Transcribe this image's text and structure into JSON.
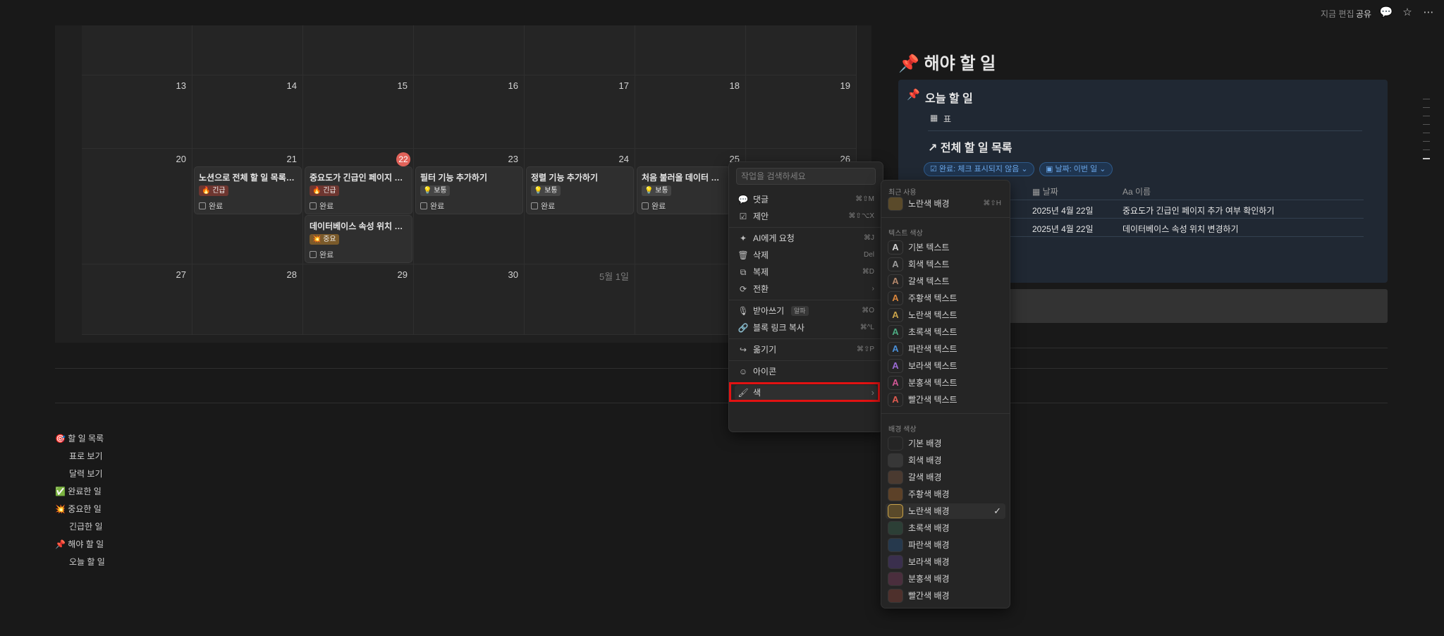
{
  "topbar": {
    "edit_status": "지금 편집",
    "share": "공유",
    "comment_icon": "comment-icon",
    "star_icon": "star-icon",
    "more_icon": "more-icon"
  },
  "calendar": {
    "row1": [
      "13",
      "14",
      "15",
      "16",
      "17",
      "18",
      "19"
    ],
    "row2": [
      "20",
      "21",
      "22",
      "23",
      "24",
      "25",
      "26"
    ],
    "row3": [
      "27",
      "28",
      "29",
      "30",
      "5월 1일"
    ],
    "today": "22",
    "cards": [
      {
        "title": "노션으로 전체 할 일 목록 만...",
        "tag": "🔥 긴급",
        "done": "완료"
      },
      {
        "title": "중요도가 긴급인 페이지 추...",
        "tag": "🔥 긴급",
        "done": "완료"
      },
      {
        "title": "데이터베이스 속성 위치 변...",
        "tag": "💥 중요",
        "done": "완료"
      },
      {
        "title": "필터 기능 추가하기",
        "tag": "💡 보통",
        "done": "완료"
      },
      {
        "title": "정렬 기능 추가하기",
        "tag": "💡 보통",
        "done": "완료"
      },
      {
        "title": "처음 불러올 데이터 개수 지",
        "tag": "💡 보통",
        "done": "완료"
      }
    ]
  },
  "toc": [
    "🎯 할 일 목록",
    "표로 보기",
    "달력 보기",
    "✅ 완료한 일",
    "💥 중요한 일",
    "긴급한 일",
    "📌 해야 할 일",
    "오늘 할 일"
  ],
  "right": {
    "title": "📌 해야 할 일",
    "callout_title": "오늘 할 일",
    "view_tab": "표",
    "db_title": "↗ 전체 할 일 목록",
    "filter1": "완료: 체크 표시되지 않음",
    "filter2": "날짜: 이번 일",
    "col_date": "날짜",
    "col_name": "Aa 이름",
    "rows": [
      {
        "date": "2025년 4월 22일",
        "name": "중요도가 긴급인 페이지 추가 여부 확인하기"
      },
      {
        "date": "2025년 4월 22일",
        "name": "데이터베이스 속성 위치 변경하기"
      }
    ]
  },
  "menu": {
    "search_placeholder": "작업을 검색하세요",
    "items": [
      {
        "icon": "💬",
        "label": "댓글",
        "shortcut": "⌘⇧M"
      },
      {
        "icon": "☑",
        "label": "제안",
        "shortcut": "⌘⇧⌥X"
      },
      {
        "icon": "✦",
        "label": "AI에게 요청",
        "shortcut": "⌘J"
      },
      {
        "icon": "🗑",
        "label": "삭제",
        "shortcut": "Del"
      },
      {
        "icon": "⧉",
        "label": "복제",
        "shortcut": "⌘D"
      },
      {
        "icon": "⟳",
        "label": "전환",
        "shortcut": "›"
      },
      {
        "icon": "🎙",
        "label": "받아쓰기",
        "badge": "알파",
        "shortcut": "⌘O"
      },
      {
        "icon": "🔗",
        "label": "블록 링크 복사",
        "shortcut": "⌘^L"
      },
      {
        "icon": "↪",
        "label": "옮기기",
        "shortcut": "⌘⇧P"
      },
      {
        "icon": "☺",
        "label": "아이콘",
        "shortcut": ""
      },
      {
        "icon": "🖌",
        "label": "색",
        "shortcut": "›"
      }
    ]
  },
  "colormenu": {
    "recent_title": "최근 사용",
    "recent_item": {
      "label": "노란색 배경",
      "shortcut": "⌘⇧H"
    },
    "text_title": "텍스트 색상",
    "text_colors": [
      {
        "label": "기본 텍스트",
        "color": "#d4d4d4"
      },
      {
        "label": "회색 텍스트",
        "color": "#9b9b9b"
      },
      {
        "label": "갈색 텍스트",
        "color": "#b4876b"
      },
      {
        "label": "주황색 텍스트",
        "color": "#d9853b"
      },
      {
        "label": "노란색 텍스트",
        "color": "#c9a34a"
      },
      {
        "label": "초록색 텍스트",
        "color": "#4dab82"
      },
      {
        "label": "파란색 텍스트",
        "color": "#4a90d9"
      },
      {
        "label": "보라색 텍스트",
        "color": "#9b6bd4"
      },
      {
        "label": "분홍색 텍스트",
        "color": "#d15796"
      },
      {
        "label": "빨간색 텍스트",
        "color": "#e05a4f"
      }
    ],
    "bg_title": "배경 색상",
    "bg_colors": [
      {
        "label": "기본 배경",
        "color": "#252525"
      },
      {
        "label": "회색 배경",
        "color": "#373737"
      },
      {
        "label": "갈색 배경",
        "color": "#4a3a30"
      },
      {
        "label": "주황색 배경",
        "color": "#5c4128"
      },
      {
        "label": "노란색 배경",
        "color": "#5a4a2a",
        "selected": "✓"
      },
      {
        "label": "초록색 배경",
        "color": "#2c3f36"
      },
      {
        "label": "파란색 배경",
        "color": "#26394d"
      },
      {
        "label": "보라색 배경",
        "color": "#3a2f4d"
      },
      {
        "label": "분홍색 배경",
        "color": "#4a2e3d"
      },
      {
        "label": "빨간색 배경",
        "color": "#4e302c"
      }
    ]
  }
}
